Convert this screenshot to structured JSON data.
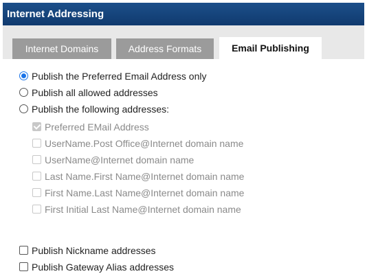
{
  "window": {
    "title": "Internet Addressing"
  },
  "tabs": [
    {
      "label": "Internet Domains",
      "active": false
    },
    {
      "label": "Address Formats",
      "active": false
    },
    {
      "label": "Email Publishing",
      "active": true
    }
  ],
  "publishing": {
    "radios": [
      {
        "label": "Publish the Preferred Email Address only",
        "selected": true
      },
      {
        "label": "Publish all allowed addresses",
        "selected": false
      },
      {
        "label": "Publish the following addresses:",
        "selected": false
      }
    ],
    "addresses": [
      {
        "label": "Preferred EMail Address",
        "checked": true,
        "disabled": true
      },
      {
        "label": "UserName.Post Office@Internet domain name",
        "checked": false,
        "disabled": true
      },
      {
        "label": "UserName@Internet domain name",
        "checked": false,
        "disabled": true
      },
      {
        "label": "Last Name.First Name@Internet domain name",
        "checked": false,
        "disabled": true
      },
      {
        "label": "First Name.Last Name@Internet domain name",
        "checked": false,
        "disabled": true
      },
      {
        "label": "First Initial Last Name@Internet domain name",
        "checked": false,
        "disabled": true
      }
    ],
    "extras": [
      {
        "label": "Publish Nickname addresses",
        "checked": false
      },
      {
        "label": "Publish Gateway Alias addresses",
        "checked": false
      }
    ]
  }
}
